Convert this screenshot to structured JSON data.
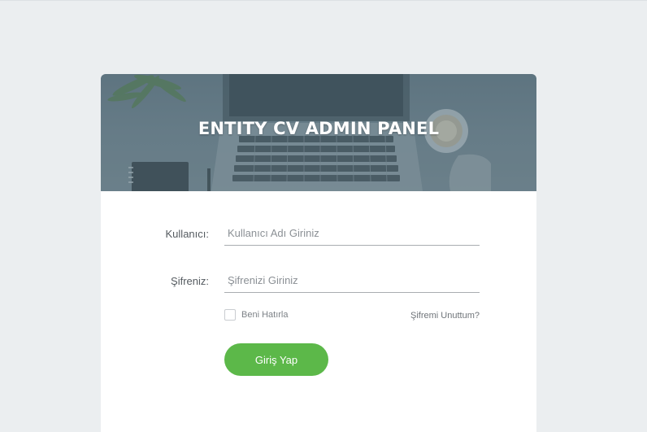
{
  "header": {
    "title": "ENTITY CV ADMIN PANEL"
  },
  "form": {
    "username": {
      "label": "Kullanıcı:",
      "placeholder": "Kullanıcı Adı Giriniz",
      "value": ""
    },
    "password": {
      "label": "Şifreniz:",
      "placeholder": "Şifrenizi Giriniz",
      "value": ""
    },
    "remember_me": {
      "label": "Beni Hatırla",
      "checked": false
    },
    "forgot_password_label": "Şifremi Unuttum?",
    "submit_label": "Giriş Yap"
  },
  "colors": {
    "background": "#ebeef0",
    "card": "#ffffff",
    "hero_overlay": "#647985",
    "primary_button": "#5cb849"
  },
  "icons": {
    "hero": "laptop-desk-photo"
  }
}
